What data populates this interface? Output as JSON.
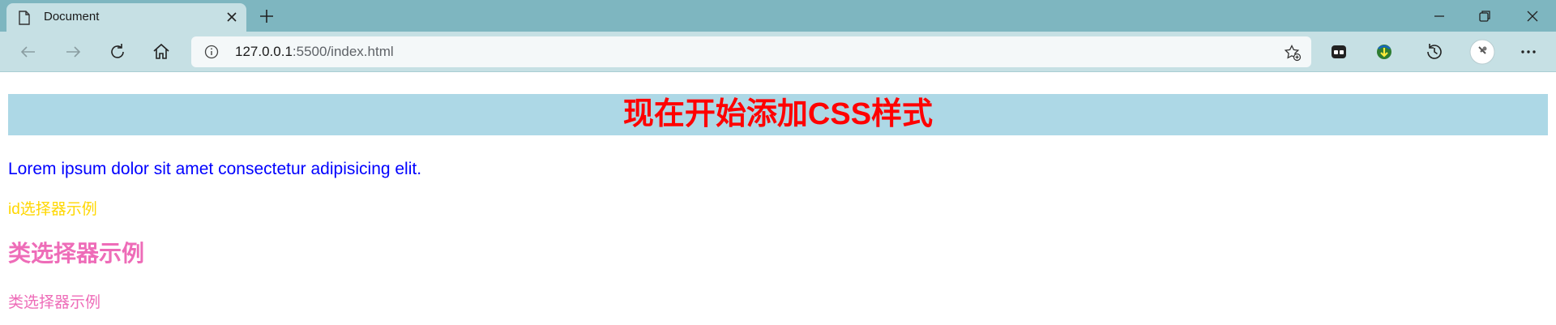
{
  "browser": {
    "tab": {
      "title": "Document",
      "icon": "document-icon"
    },
    "address_bar": {
      "url_host": "127.0.0.1",
      "url_rest": ":5500/index.html",
      "info_icon": "info-icon"
    },
    "colors": {
      "titlebar": "#7eb6c0",
      "toolbar": "#c6e0e4",
      "address_bg": "#f4f8f9"
    }
  },
  "page": {
    "heading": "现在开始添加CSS样式",
    "paragraph": "Lorem ipsum dolor sit amet consectetur adipisicing elit.",
    "id_example": "id选择器示例",
    "class_heading": "类选择器示例",
    "class_paragraph": "类选择器示例",
    "colors": {
      "heading_bg": "#add8e6",
      "heading_text": "#ff0000",
      "paragraph": "#0000ff",
      "id_example": "#ffd700",
      "class_text": "#ee6cb8"
    }
  }
}
